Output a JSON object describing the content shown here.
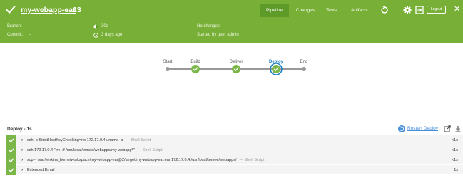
{
  "header": {
    "pipeline_name": "my-webapp-ear",
    "back_glyph": "‹",
    "run_number": "13",
    "status_icon": "check-icon",
    "tabs": [
      {
        "label": "Pipeline",
        "active": true
      },
      {
        "label": "Changes",
        "active": false
      },
      {
        "label": "Tests",
        "active": false
      },
      {
        "label": "Artifacts",
        "active": false
      }
    ],
    "logout_label": "Logout",
    "close_glyph": "✕",
    "icons": [
      "replay-icon",
      "gear-icon",
      "exit-icon",
      "close-icon"
    ]
  },
  "meta": {
    "branch_label": "Branch:",
    "branch_value": "–",
    "commit_label": "Commit:",
    "commit_value": "–",
    "duration": "30s",
    "started_ago": "3 days ago",
    "changes": "No changes",
    "started_by": "Started by user admin"
  },
  "stages": [
    {
      "label": "Start",
      "type": "terminal"
    },
    {
      "label": "Build",
      "type": "success"
    },
    {
      "label": "Deliver",
      "type": "success"
    },
    {
      "label": "Deploy",
      "type": "selected"
    },
    {
      "label": "End",
      "type": "terminal"
    }
  ],
  "detail": {
    "title": "Deploy - 1s",
    "restart_label": "Restart Deploy",
    "steps": [
      {
        "command": "ssh -o StrictHostKeyChecking=no 172.17.0.4 uname -a",
        "kind": "— Shell Script",
        "duration": "<1s"
      },
      {
        "command": "ssh 172.17.0.4 \"rm -rf /usr/local/tomee/webapps/my-webapp*\"",
        "kind": "— Shell Script",
        "duration": "<1s"
      },
      {
        "command": "scp -r /var/jenkins_home/workspace/my-webapp-ear@2/target/my-webapp-ear.ear 172.17.0.4:/usr/local/tomee/webapps/",
        "kind": "— Shell Script",
        "duration": "<1s"
      },
      {
        "command": "Extended Email",
        "kind": "",
        "duration": "1s"
      }
    ]
  },
  "colors": {
    "header": "#78b037",
    "success": "#7ab648",
    "selected": "#1f7fc4"
  }
}
